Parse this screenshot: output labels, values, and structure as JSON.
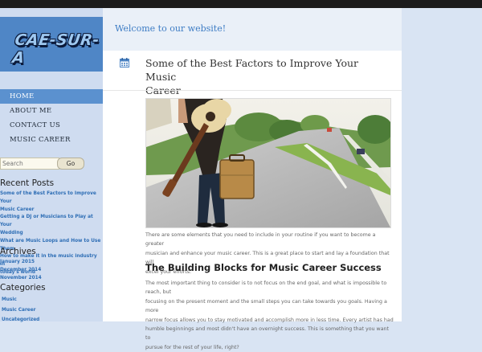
{
  "site": {
    "logo_text": "CAE-SUR-A",
    "welcome": "Welcome to our website!"
  },
  "nav": {
    "items": [
      {
        "label": "HOME",
        "active": true
      },
      {
        "label": "ABOUT ME",
        "active": false
      },
      {
        "label": "CONTACT US",
        "active": false
      },
      {
        "label": "MUSIC CAREER",
        "active": false
      }
    ]
  },
  "search": {
    "placeholder": "Search",
    "button_label": "Go"
  },
  "widgets": {
    "recent_posts": {
      "title": "Recent Posts",
      "links": [
        "Some of the Best Factors to Improve Your",
        "Music Career",
        "Getting a DJ or Musicians to Play at Your",
        "Wedding",
        "What are Music Loops and How to Use Them",
        "How to make it in the music industry in",
        "today's world"
      ]
    },
    "archives": {
      "title": "Archives",
      "links": [
        "January 2015",
        "December 2014",
        "November 2014"
      ]
    },
    "categories": {
      "title": "Categories",
      "links": [
        "Music",
        "Music Career",
        "Uncategorized"
      ]
    }
  },
  "post": {
    "title_line1": "Some of the Best Factors to Improve Your Music",
    "title_line2": "Career",
    "intro_line1": "There are some elements that you need to include in your routine if you want to become a greater",
    "intro_line2": "musician and enhance your music career.  This is a great place to start and lay a foundation that will",
    "intro_line3": "excel your efforts.",
    "heading": "The Building Blocks for Music Career Success",
    "para_line1": "The most important thing to consider is to not focus on the end goal, and what is impossible to reach, but",
    "para_line2": "focusing on the present moment and the small steps you can take towards you goals.  Having a more",
    "para_line3": "narrow focus allows you to stay motivated and accomplish more in less time.  Every artist has had",
    "para_line4": "humble beginnings and most didn't have an overnight success.  This is something that you want to",
    "para_line5": "pursue for the rest of your life, right?"
  },
  "colors": {
    "accent": "#3d7cc4",
    "nav_active": "#5b91cf",
    "sidebar_bg": "#cfdcf0",
    "link": "#2e6eb5"
  },
  "icons": {
    "post_date": "calendar-icon"
  }
}
